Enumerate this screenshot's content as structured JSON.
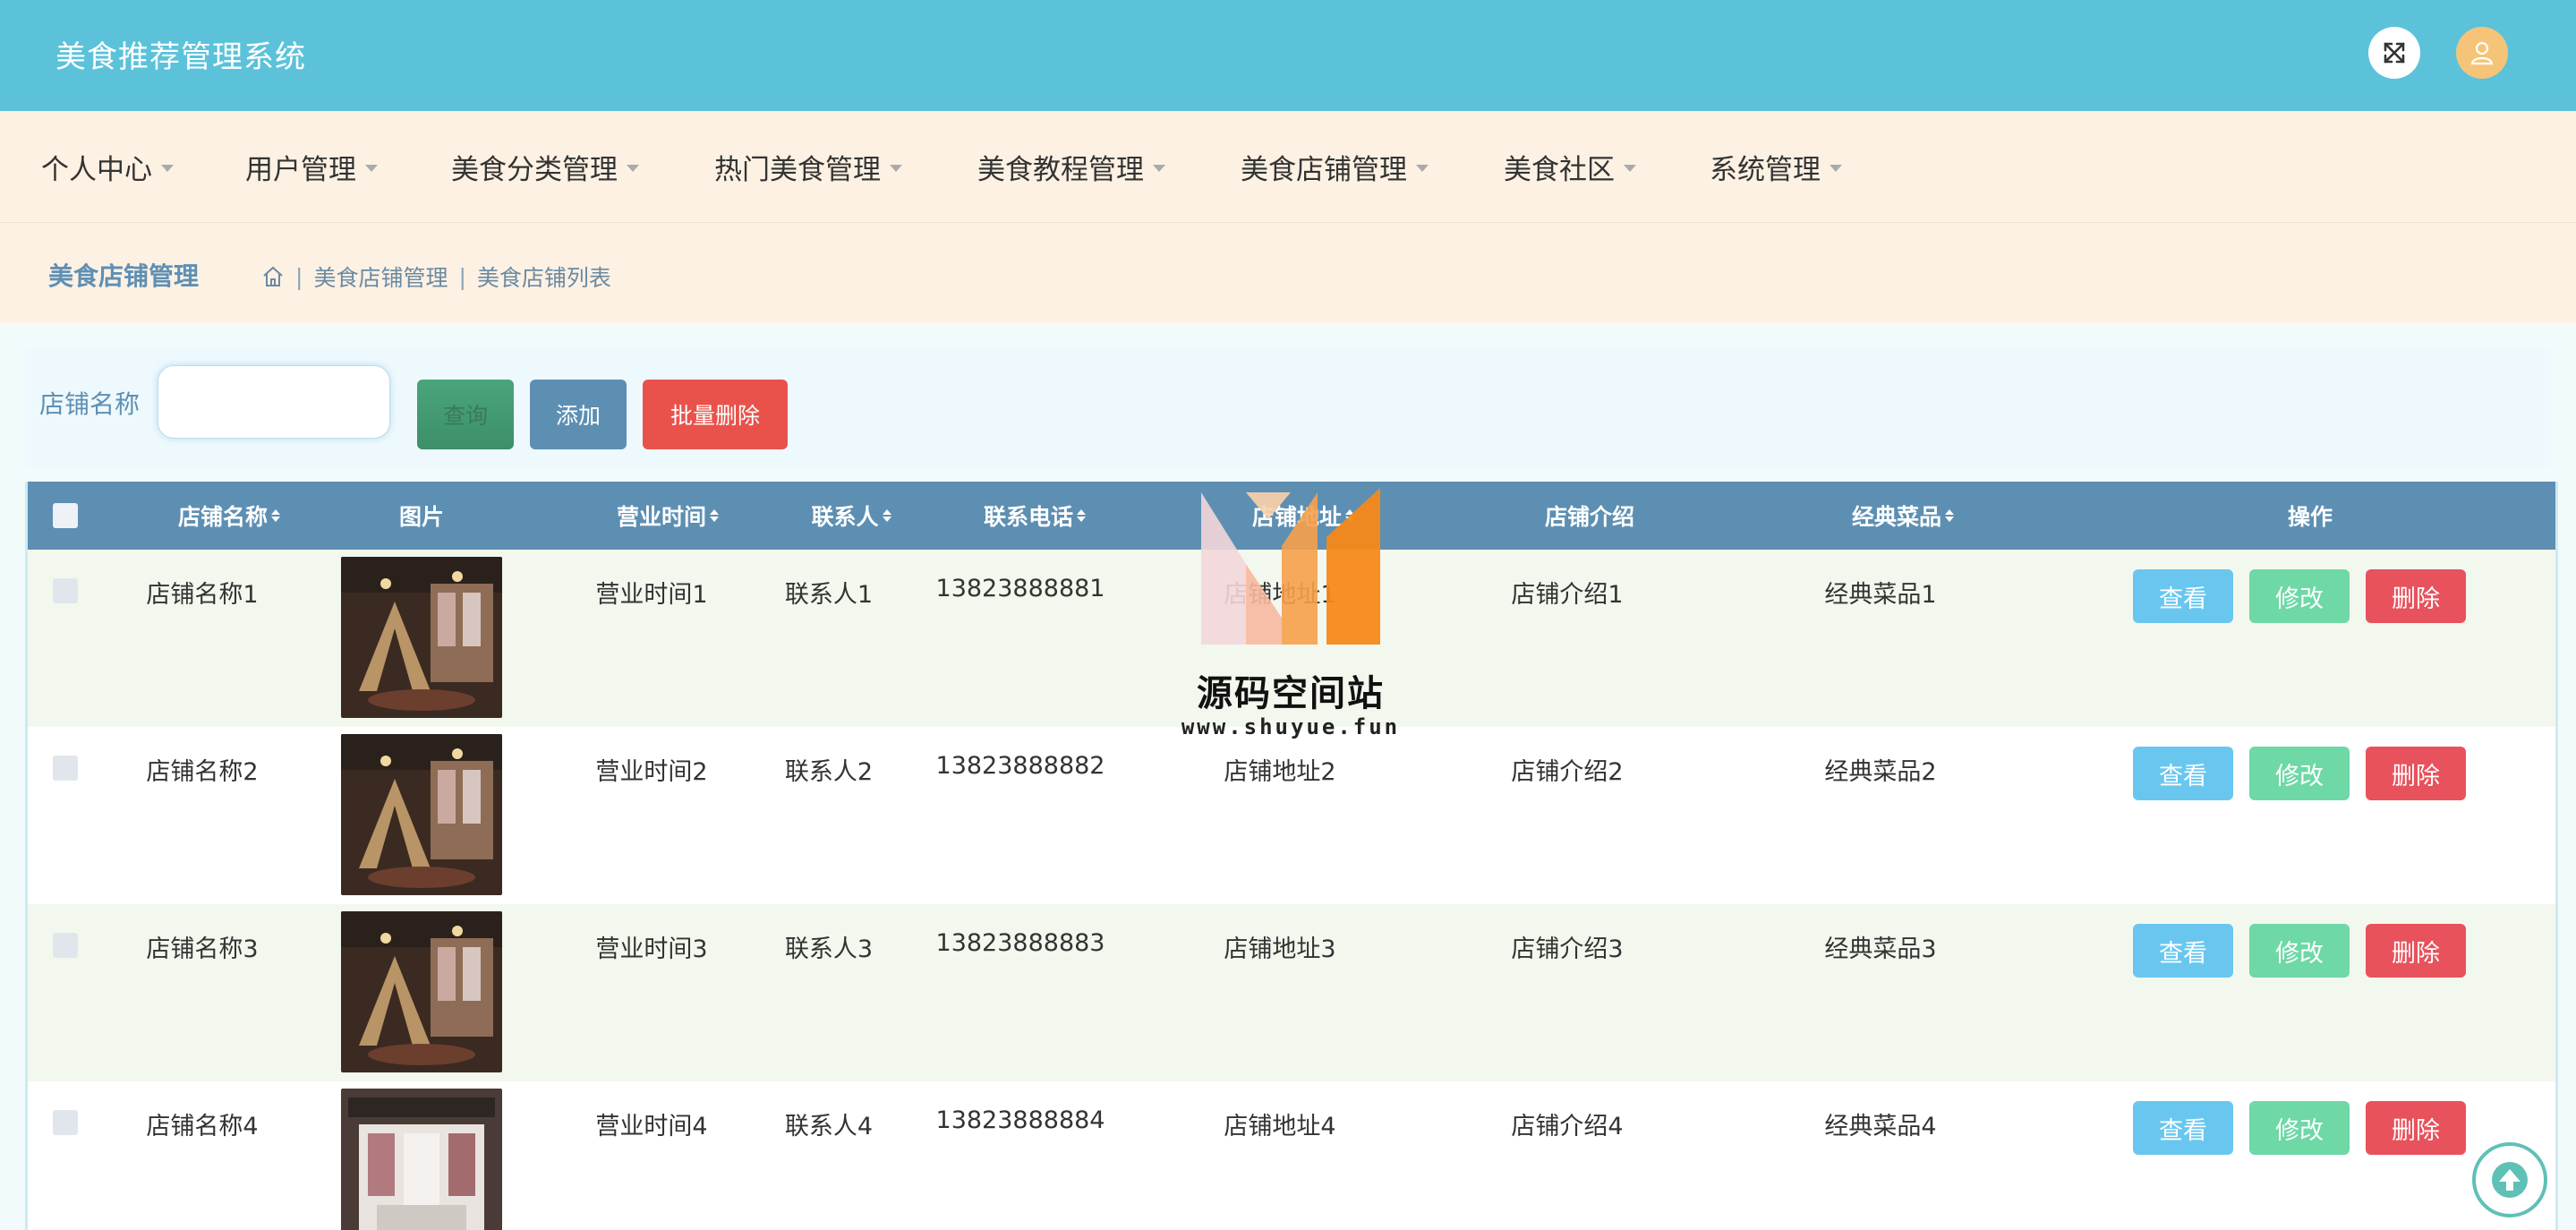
{
  "app": {
    "title": "美食推荐管理系统"
  },
  "header": {
    "fullscreen_icon": "fullscreen-icon",
    "avatar_icon": "user-icon",
    "accent": "#5bc2da"
  },
  "nav": {
    "items": [
      {
        "label": "个人中心"
      },
      {
        "label": "用户管理"
      },
      {
        "label": "美食分类管理"
      },
      {
        "label": "热门美食管理"
      },
      {
        "label": "美食教程管理"
      },
      {
        "label": "美食店铺管理"
      },
      {
        "label": "美食社区"
      },
      {
        "label": "系统管理"
      }
    ]
  },
  "breadcrumb": {
    "title": "美食店铺管理",
    "home_icon": "home-icon",
    "level1": "美食店铺管理",
    "level2": "美食店铺列表"
  },
  "search": {
    "label": "店铺名称",
    "value": "",
    "query_button": "查询",
    "add_button": "添加",
    "batch_delete_button": "批量删除"
  },
  "table": {
    "headers": {
      "name": "店铺名称",
      "image": "图片",
      "hours": "营业时间",
      "contact": "联系人",
      "phone": "联系电话",
      "address": "店铺地址",
      "intro": "店铺介绍",
      "dishes": "经典菜品",
      "actions": "操作"
    },
    "actions": {
      "view": "查看",
      "edit": "修改",
      "delete": "删除"
    },
    "rows": [
      {
        "name": "店铺名称1",
        "hours": "营业时间1",
        "contact": "联系人1",
        "phone": "13823888881",
        "address": "店铺地址1",
        "intro": "店铺介绍1",
        "dishes": "经典菜品1"
      },
      {
        "name": "店铺名称2",
        "hours": "营业时间2",
        "contact": "联系人2",
        "phone": "13823888882",
        "address": "店铺地址2",
        "intro": "店铺介绍2",
        "dishes": "经典菜品2"
      },
      {
        "name": "店铺名称3",
        "hours": "营业时间3",
        "contact": "联系人3",
        "phone": "13823888883",
        "address": "店铺地址3",
        "intro": "店铺介绍3",
        "dishes": "经典菜品3"
      },
      {
        "name": "店铺名称4",
        "hours": "营业时间4",
        "contact": "联系人4",
        "phone": "13823888884",
        "address": "店铺地址4",
        "intro": "店铺介绍4",
        "dishes": "经典菜品4"
      }
    ]
  },
  "watermark": {
    "name": "源码空间站",
    "url": "www.shuyue.fun"
  }
}
